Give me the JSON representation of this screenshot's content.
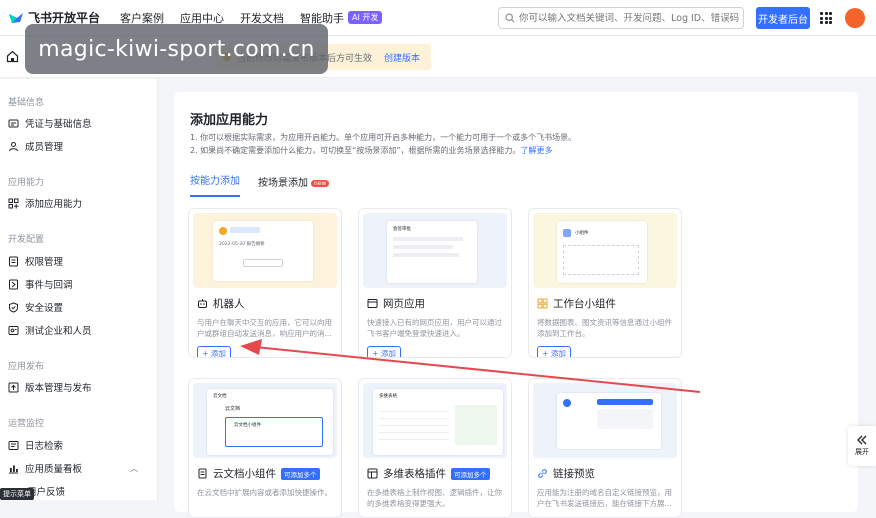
{
  "topbar": {
    "logo_text": "飞书开放平台",
    "nav": [
      "客户案例",
      "应用中心",
      "开发文档",
      "智能助手"
    ],
    "ai_badge": "AI 开发",
    "search_placeholder": "你可以输入文档关键词、开发问题、Log ID、错误码",
    "dev_console": "开发者后台"
  },
  "subbar": {
    "notice_text": "当前修改均需发布版本后方可生效",
    "notice_link": "创建版本"
  },
  "watermark": "magic-kiwi-sport.com.cn",
  "sidebar": {
    "sections": [
      {
        "title": "基础信息",
        "items": [
          "凭证与基础信息",
          "成员管理"
        ]
      },
      {
        "title": "应用能力",
        "items": [
          "添加应用能力"
        ]
      },
      {
        "title": "开发配置",
        "items": [
          "权限管理",
          "事件与回调",
          "安全设置",
          "测试企业和人员"
        ]
      },
      {
        "title": "应用发布",
        "items": [
          "版本管理与发布"
        ]
      },
      {
        "title": "运营监控",
        "items": [
          "日志检索",
          "应用质量看板",
          "用户反馈"
        ]
      }
    ],
    "tooltip": "提示菜单"
  },
  "main": {
    "title": "添加应用能力",
    "desc1": "1. 你可以根据实际需求，为应用开启能力。单个应用可开启多种能力，一个能力可用于一个或多个飞书场景。",
    "desc2": "2. 如果尚不确定需要添加什么能力，可切换至“按场景添加”，根据所需的业务场景选择能力。",
    "learn_more": "了解更多",
    "tabs": [
      "按能力添加",
      "按场景添加"
    ],
    "new_badge": "new",
    "add_label": "+ 添加",
    "cards": [
      {
        "title": "机器人",
        "desc": "与用户在聊天中交互的应用，它可以向用户或群组自动发送消息，响应用户的消..."
      },
      {
        "title": "网页应用",
        "desc": "快速接入已有的网页应用，用户可以通过飞书客户端免登录快速进入。"
      },
      {
        "title": "工作台小组件",
        "desc": "将数据图表、图文资讯等信息通过小组件添加到工作台。"
      },
      {
        "title": "云文档小组件",
        "tag": "可添加多个",
        "desc": "在云文档中扩展内容或者添加快捷操作。"
      },
      {
        "title": "多维表格插件",
        "tag": "可添加多个",
        "desc": "在多维表格上制作视图、逻辑插件，让你的多维表格变得更强大。"
      },
      {
        "title": "链接预览",
        "desc": "应用能为注册的域名自定义链接预览，用户在飞书发送链接后，能在链接下方展..."
      }
    ],
    "mock_texts": {
      "bot_date": "2022-05-20 报告摘要",
      "web_title": "会签审批",
      "widget_title": "小组件",
      "doc_header": "云文档",
      "doc_sub": "云文档",
      "doc_inner": "云文档小组件",
      "base_title": "多维表格"
    }
  },
  "expand_label": "展开",
  "colors": {
    "accent": "#3370ff",
    "arrow": "#e5484d"
  }
}
